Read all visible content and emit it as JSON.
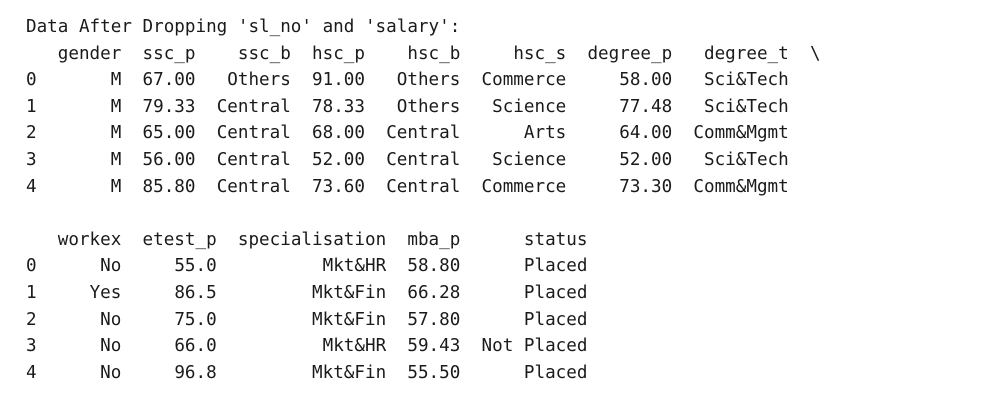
{
  "output": {
    "heading": "Data After Dropping 'sl_no' and 'salary':",
    "continuation_mark": "\\",
    "blocks": [
      {
        "columns": [
          "gender",
          "ssc_p",
          "ssc_b",
          "hsc_p",
          "hsc_b",
          "hsc_s",
          "degree_p",
          "degree_t"
        ],
        "align": [
          "r",
          "r",
          "r",
          "r",
          "r",
          "r",
          "r",
          "r"
        ],
        "continues": true,
        "rows": [
          {
            "index": "0",
            "cells": [
              "M",
              "67.00",
              "Others",
              "91.00",
              "Others",
              "Commerce",
              "58.00",
              "Sci&Tech"
            ]
          },
          {
            "index": "1",
            "cells": [
              "M",
              "79.33",
              "Central",
              "78.33",
              "Others",
              "Science",
              "77.48",
              "Sci&Tech"
            ]
          },
          {
            "index": "2",
            "cells": [
              "M",
              "65.00",
              "Central",
              "68.00",
              "Central",
              "Arts",
              "64.00",
              "Comm&Mgmt"
            ]
          },
          {
            "index": "3",
            "cells": [
              "M",
              "56.00",
              "Central",
              "52.00",
              "Central",
              "Science",
              "52.00",
              "Sci&Tech"
            ]
          },
          {
            "index": "4",
            "cells": [
              "M",
              "85.80",
              "Central",
              "73.60",
              "Central",
              "Commerce",
              "73.30",
              "Comm&Mgmt"
            ]
          }
        ]
      },
      {
        "columns": [
          "workex",
          "etest_p",
          "specialisation",
          "mba_p",
          "status"
        ],
        "align": [
          "r",
          "r",
          "r",
          "r",
          "r"
        ],
        "continues": false,
        "rows": [
          {
            "index": "0",
            "cells": [
              "No",
              "55.0",
              "Mkt&HR",
              "58.80",
              "Placed"
            ]
          },
          {
            "index": "1",
            "cells": [
              "Yes",
              "86.5",
              "Mkt&Fin",
              "66.28",
              "Placed"
            ]
          },
          {
            "index": "2",
            "cells": [
              "No",
              "75.0",
              "Mkt&Fin",
              "57.80",
              "Placed"
            ]
          },
          {
            "index": "3",
            "cells": [
              "No",
              "66.0",
              "Mkt&HR",
              "59.43",
              "Not Placed"
            ]
          },
          {
            "index": "4",
            "cells": [
              "No",
              "96.8",
              "Mkt&Fin",
              "55.50",
              "Placed"
            ]
          }
        ]
      }
    ]
  }
}
